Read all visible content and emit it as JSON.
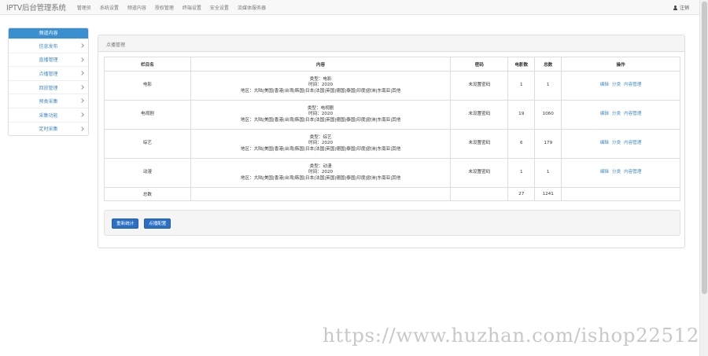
{
  "header": {
    "brand": "IPTV后台管理系统",
    "nav": [
      "管理员",
      "系统设置",
      "频道内容",
      "授权管理",
      "终端设置",
      "安全设置",
      "流媒体服务器"
    ],
    "logout": "注销"
  },
  "sidebar": {
    "title": "频道内容",
    "items": [
      "信息发布",
      "直播管理",
      "点播管理",
      "回放管理",
      "预类采集",
      "采集功能",
      "定时采集"
    ]
  },
  "panel": {
    "title": "点播管理",
    "table": {
      "headers": [
        "栏目名",
        "内容",
        "密码",
        "电影数",
        "总数",
        "操作"
      ],
      "rows": [
        {
          "name": "电影",
          "type": "类型：电影",
          "time": "时间：2020",
          "region": "地区：大陆|美国|香港|台湾|韩国|日本|法国|英国|德国|泰国|印度|欧洲|东南亚|其他",
          "password": "未设置密码",
          "movies": "1",
          "total": "1"
        },
        {
          "name": "电视剧",
          "type": "类型：电视剧",
          "time": "时间：2020",
          "region": "地区：大陆|美国|香港|台湾|韩国|日本|法国|英国|德国|泰国|印度|欧洲|东南亚|其他",
          "password": "未设置密码",
          "movies": "19",
          "total": "1060"
        },
        {
          "name": "综艺",
          "type": "类型：综艺",
          "time": "时间：2020",
          "region": "地区：大陆|美国|香港|台湾|韩国|日本|法国|英国|德国|泰国|印度|欧洲|东南亚|其他",
          "password": "未设置密码",
          "movies": "6",
          "total": "179"
        },
        {
          "name": "动漫",
          "type": "类型：动漫",
          "time": "时间：2020",
          "region": "地区：大陆|美国|香港|台湾|韩国|日本|法国|英国|德国|泰国|印度|欧洲|东南亚|其他",
          "password": "未设置密码",
          "movies": "1",
          "total": "1"
        }
      ],
      "actions": [
        "编辑",
        "分类",
        "内容管理"
      ],
      "total_row": {
        "label": "总数",
        "movies": "27",
        "total": "1241"
      }
    },
    "buttons": {
      "recount": "重新统计",
      "config": "点播配置"
    }
  },
  "watermark": "https://www.huzhan.com/ishop22512"
}
